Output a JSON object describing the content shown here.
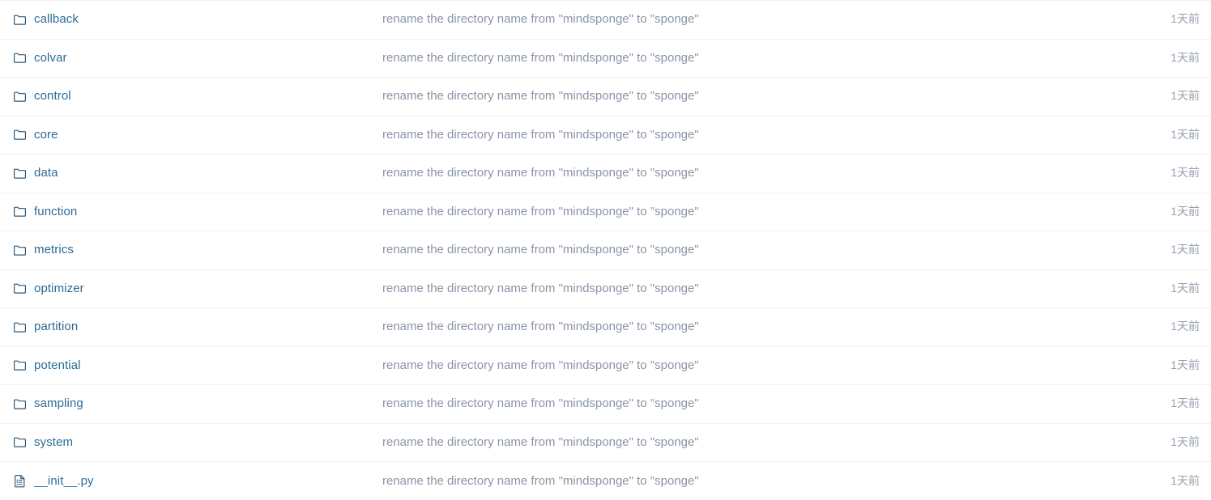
{
  "file_list": {
    "commit_message": "rename the directory name from \"mindsponge\" to \"sponge\"",
    "age_label": "1天前",
    "rows": [
      {
        "name": "callback",
        "type": "folder",
        "icon": "folder-icon",
        "message": "rename the directory name from \"mindsponge\" to \"sponge\"",
        "age": "1天前"
      },
      {
        "name": "colvar",
        "type": "folder",
        "icon": "folder-icon",
        "message": "rename the directory name from \"mindsponge\" to \"sponge\"",
        "age": "1天前"
      },
      {
        "name": "control",
        "type": "folder",
        "icon": "folder-icon",
        "message": "rename the directory name from \"mindsponge\" to \"sponge\"",
        "age": "1天前"
      },
      {
        "name": "core",
        "type": "folder",
        "icon": "folder-icon",
        "message": "rename the directory name from \"mindsponge\" to \"sponge\"",
        "age": "1天前"
      },
      {
        "name": "data",
        "type": "folder",
        "icon": "folder-icon",
        "message": "rename the directory name from \"mindsponge\" to \"sponge\"",
        "age": "1天前"
      },
      {
        "name": "function",
        "type": "folder",
        "icon": "folder-icon",
        "message": "rename the directory name from \"mindsponge\" to \"sponge\"",
        "age": "1天前"
      },
      {
        "name": "metrics",
        "type": "folder",
        "icon": "folder-icon",
        "message": "rename the directory name from \"mindsponge\" to \"sponge\"",
        "age": "1天前"
      },
      {
        "name": "optimizer",
        "type": "folder",
        "icon": "folder-icon",
        "message": "rename the directory name from \"mindsponge\" to \"sponge\"",
        "age": "1天前"
      },
      {
        "name": "partition",
        "type": "folder",
        "icon": "folder-icon",
        "message": "rename the directory name from \"mindsponge\" to \"sponge\"",
        "age": "1天前"
      },
      {
        "name": "potential",
        "type": "folder",
        "icon": "folder-icon",
        "message": "rename the directory name from \"mindsponge\" to \"sponge\"",
        "age": "1天前"
      },
      {
        "name": "sampling",
        "type": "folder",
        "icon": "folder-icon",
        "message": "rename the directory name from \"mindsponge\" to \"sponge\"",
        "age": "1天前"
      },
      {
        "name": "system",
        "type": "folder",
        "icon": "folder-icon",
        "message": "rename the directory name from \"mindsponge\" to \"sponge\"",
        "age": "1天前"
      },
      {
        "name": "__init__.py",
        "type": "file",
        "icon": "file-icon",
        "message": "rename the directory name from \"mindsponge\" to \"sponge\"",
        "age": "1天前"
      }
    ]
  },
  "colors": {
    "link": "#2c6b96",
    "icon": "#2c5777",
    "message": "#8a94a6",
    "age": "#97a0ae",
    "divider": "#eef1f4",
    "background": "#ffffff"
  }
}
